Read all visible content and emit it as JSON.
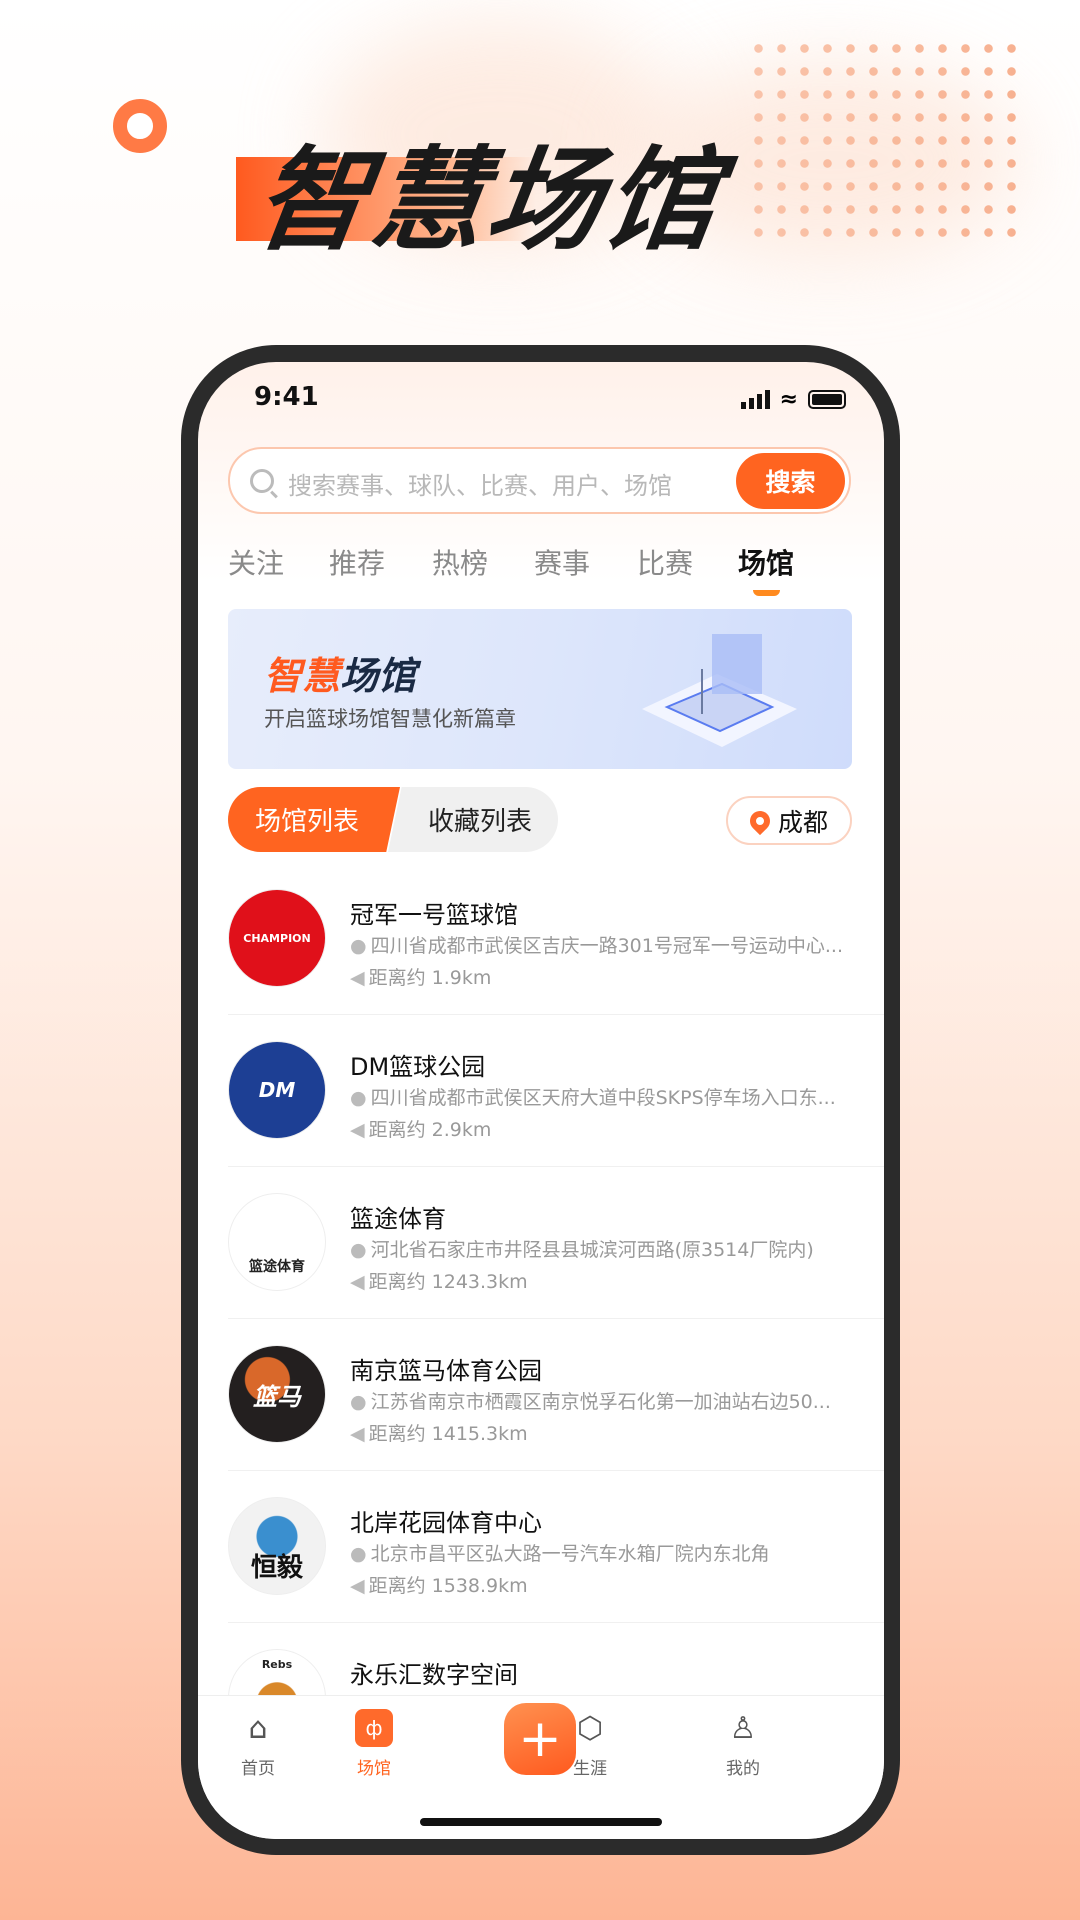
{
  "hero": {
    "title": "智慧场馆"
  },
  "status": {
    "time": "9:41"
  },
  "search": {
    "placeholder": "搜索赛事、球队、比赛、用户、场馆",
    "button": "搜索"
  },
  "tabs": [
    {
      "label": "关注"
    },
    {
      "label": "推荐"
    },
    {
      "label": "热榜"
    },
    {
      "label": "赛事"
    },
    {
      "label": "比赛"
    },
    {
      "label": "场馆",
      "active": true
    }
  ],
  "banner": {
    "title_accent": "智慧",
    "title_rest": "场馆",
    "subtitle": "开启篮球场馆智慧化新篇章"
  },
  "segment": {
    "active": "场馆列表",
    "inactive": "收藏列表"
  },
  "city": {
    "label": "成都",
    "icon": "location-pin-icon"
  },
  "venues": [
    {
      "name": "冠军一号篮球馆",
      "address": "四川省成都市武侯区吉庆一路301号冠军一号运动中心...",
      "distance": "距离约 1.9km",
      "logo_text": "CHAMPION",
      "logo_color": "#e0101a"
    },
    {
      "name": "DM篮球公园",
      "address": "四川省成都市武侯区天府大道中段SKPS停车场入口东...",
      "distance": "距离约 2.9km",
      "logo_text": "DM",
      "logo_color": "#1d3f94"
    },
    {
      "name": "篮途体育",
      "address": "河北省石家庄市井陉县县城滨河西路(原3514厂院内)",
      "distance": "距离约 1243.3km",
      "logo_text": "篮途体育",
      "logo_color": "#ffffff"
    },
    {
      "name": "南京篮马体育公园",
      "address": "江苏省南京市栖霞区南京悦孚石化第一加油站右边50...",
      "distance": "距离约 1415.3km",
      "logo_text": "篮马",
      "logo_color": "#231f1f"
    },
    {
      "name": "北岸花园体育中心",
      "address": "北京市昌平区弘大路一号汽车水箱厂院内东北角",
      "distance": "距离约 1538.9km",
      "logo_text": "恒毅",
      "logo_color": "#f2f2f2"
    },
    {
      "name": "永乐汇数字空间",
      "address": "",
      "distance": "",
      "logo_text": "Rebs",
      "logo_color": "#ffffff"
    }
  ],
  "nav": [
    {
      "label": "首页",
      "icon": "home-icon"
    },
    {
      "label": "场馆",
      "icon": "venue-icon",
      "active": true
    },
    {
      "label": "+",
      "icon": "plus-icon"
    },
    {
      "label": "生涯",
      "icon": "career-badge-icon"
    },
    {
      "label": "我的",
      "icon": "profile-icon"
    }
  ],
  "colors": {
    "accent": "#ff6420",
    "bg_bottom": "#fdb595"
  }
}
